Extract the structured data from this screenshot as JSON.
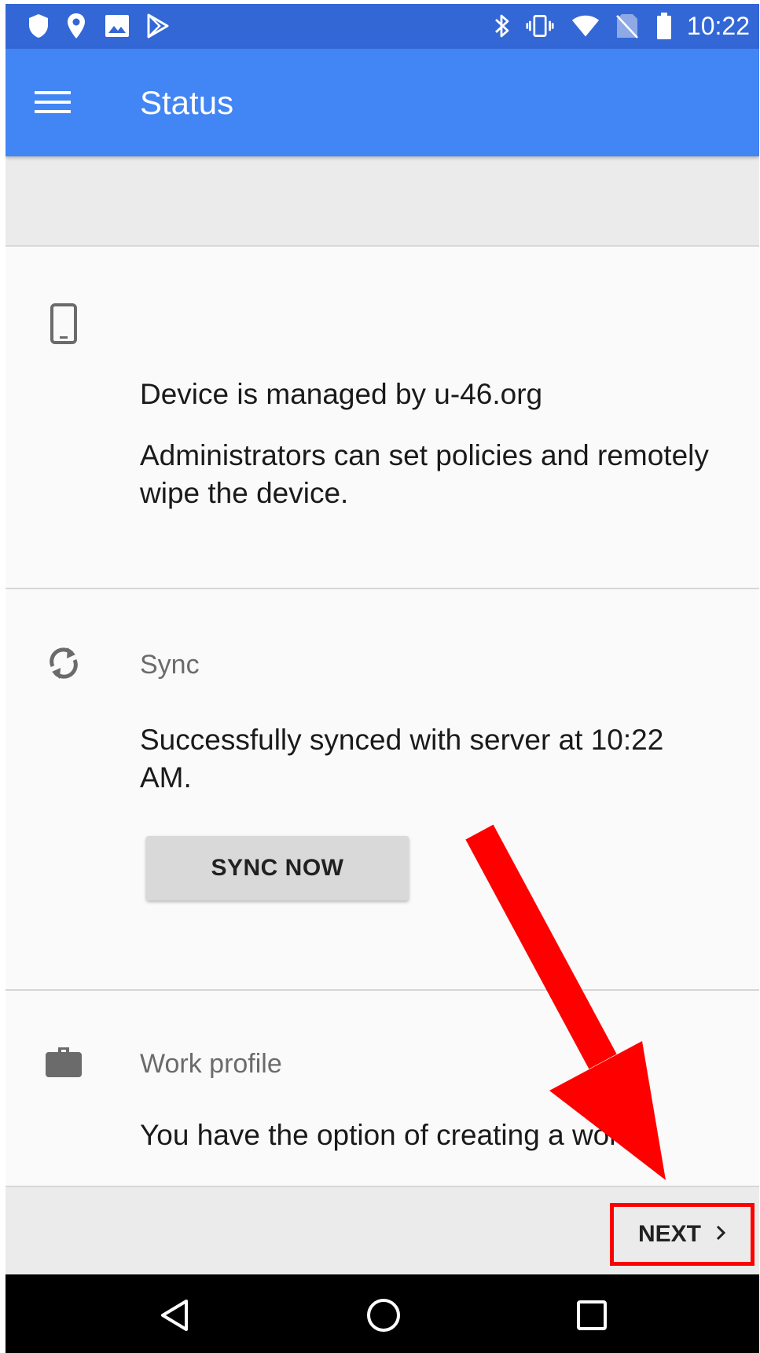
{
  "status_bar": {
    "time": "10:22",
    "icons_left": [
      "shield-icon",
      "location-pin-icon",
      "image-icon",
      "play-store-icon"
    ],
    "icons_right": [
      "bluetooth-icon",
      "vibrate-icon",
      "wifi-icon",
      "no-sim-icon",
      "battery-icon"
    ]
  },
  "app_bar": {
    "title": "Status",
    "menu_icon": "hamburger-menu-icon"
  },
  "cards": {
    "device": {
      "icon": "smartphone-icon",
      "heading": "Device is managed by u-46.org",
      "description": "Administrators can set policies and remotely wipe the device."
    },
    "sync": {
      "icon": "sync-icon",
      "title": "Sync",
      "message": "Successfully synced with server at 10:22 AM.",
      "button_label": "SYNC NOW"
    },
    "work_profile": {
      "icon": "briefcase-icon",
      "title": "Work profile",
      "message": "You have the option of creating a work"
    }
  },
  "action_bar": {
    "next_label": "NEXT",
    "next_icon": "chevron-right-icon"
  },
  "nav_bar": {
    "icons": [
      "back-icon",
      "home-icon",
      "recents-icon"
    ]
  },
  "colors": {
    "status_bar": "#3367d6",
    "app_bar": "#4285f4",
    "annotation": "#ff0000"
  }
}
